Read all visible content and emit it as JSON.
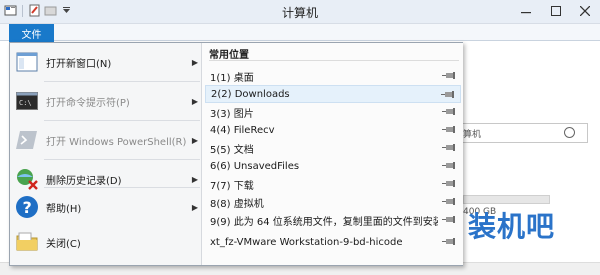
{
  "window": {
    "title": "计算机"
  },
  "ribbon": {
    "file_tab": "文件"
  },
  "background": {
    "search_text": "算机",
    "drive_size": "400 GB",
    "watermark": "装机吧"
  },
  "menu": {
    "left_items": [
      {
        "label": "打开新窗口(N)",
        "disabled": false,
        "icon": "new-window-icon",
        "has_arrow": true
      },
      {
        "label": "打开命令提示符(P)",
        "disabled": true,
        "icon": "cmd-icon",
        "has_arrow": true
      },
      {
        "label": "打开 Windows PowerShell(R)",
        "disabled": true,
        "icon": "powershell-icon",
        "has_arrow": true
      },
      {
        "label": "删除历史记录(D)",
        "disabled": false,
        "icon": "delete-history-icon",
        "has_arrow": true
      },
      {
        "label": "帮助(H)",
        "disabled": false,
        "icon": "help-icon",
        "has_arrow": true
      },
      {
        "label": "关闭(C)",
        "disabled": false,
        "icon": "close-folder-icon",
        "has_arrow": false
      }
    ],
    "frequent_header": "常用位置",
    "frequent_items": [
      {
        "label": "1(1)  桌面",
        "highlighted": false
      },
      {
        "label": "2(2)  Downloads",
        "highlighted": true
      },
      {
        "label": "3(3)  图片",
        "highlighted": false
      },
      {
        "label": "4(4)  FileRecv",
        "highlighted": false
      },
      {
        "label": "5(5)  文档",
        "highlighted": false
      },
      {
        "label": "6(6)  UnsavedFiles",
        "highlighted": false
      },
      {
        "label": "7(7)  下载",
        "highlighted": false
      },
      {
        "label": "8(8)  虚拟机",
        "highlighted": false
      },
      {
        "label": "9(9)  此为 64 位系统用文件，复制里面的文件到安装...",
        "highlighted": false
      },
      {
        "label": "      xt_fz-VMware Workstation-9-bd-hicode",
        "highlighted": false
      }
    ]
  },
  "colors": {
    "accent": "#1979ca",
    "highlight": "#e5f1fb",
    "watermark": "#2a73c9"
  }
}
